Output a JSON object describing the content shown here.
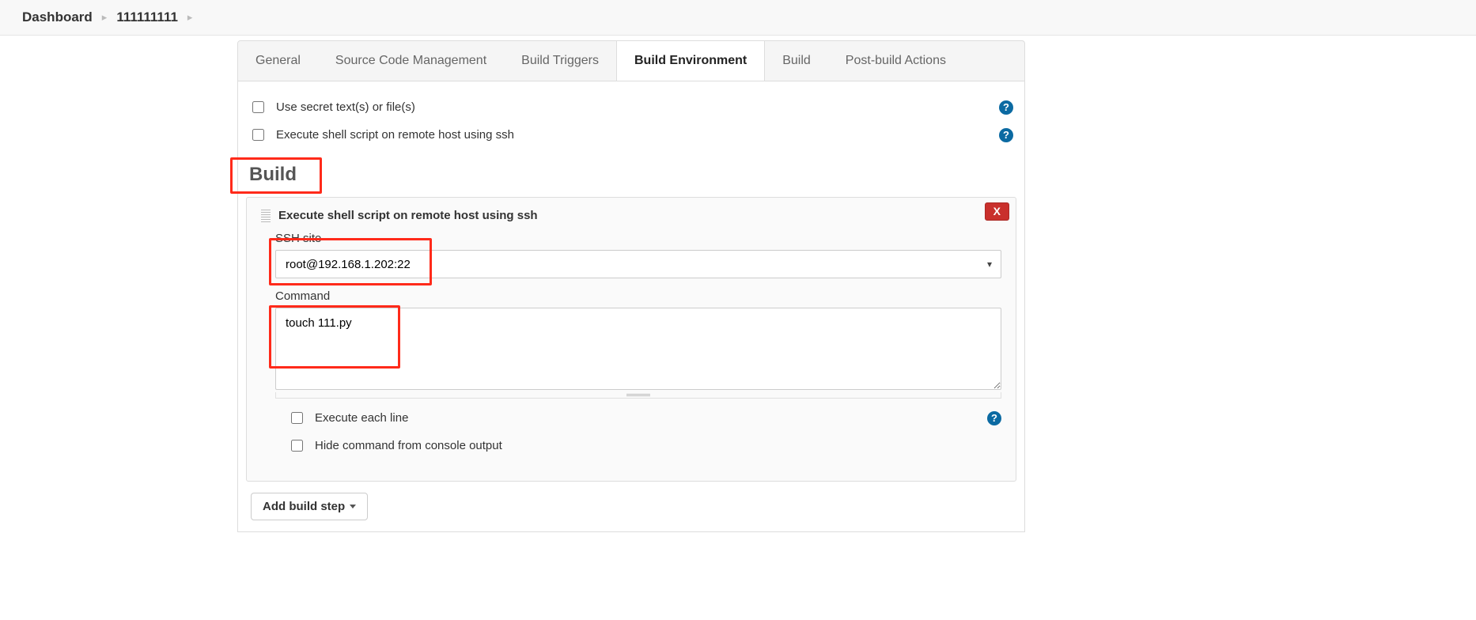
{
  "breadcrumb": {
    "item0": "Dashboard",
    "item1": "111111111"
  },
  "tabs": {
    "general": "General",
    "scm": "Source Code Management",
    "triggers": "Build Triggers",
    "env": "Build Environment",
    "build": "Build",
    "postbuild": "Post-build Actions"
  },
  "env": {
    "secret_text_label": "Use secret text(s) or file(s)",
    "ssh_label": "Execute shell script on remote host using ssh"
  },
  "build": {
    "heading": "Build",
    "step_title": "Execute shell script on remote host using ssh",
    "delete_label": "X",
    "ssh_site_label": "SSH site",
    "ssh_site_value": "root@192.168.1.202:22",
    "command_label": "Command",
    "command_value": "touch 111.py",
    "execute_each_line_label": "Execute each line",
    "hide_command_label": "Hide command from console output",
    "add_step_label": "Add build step"
  }
}
